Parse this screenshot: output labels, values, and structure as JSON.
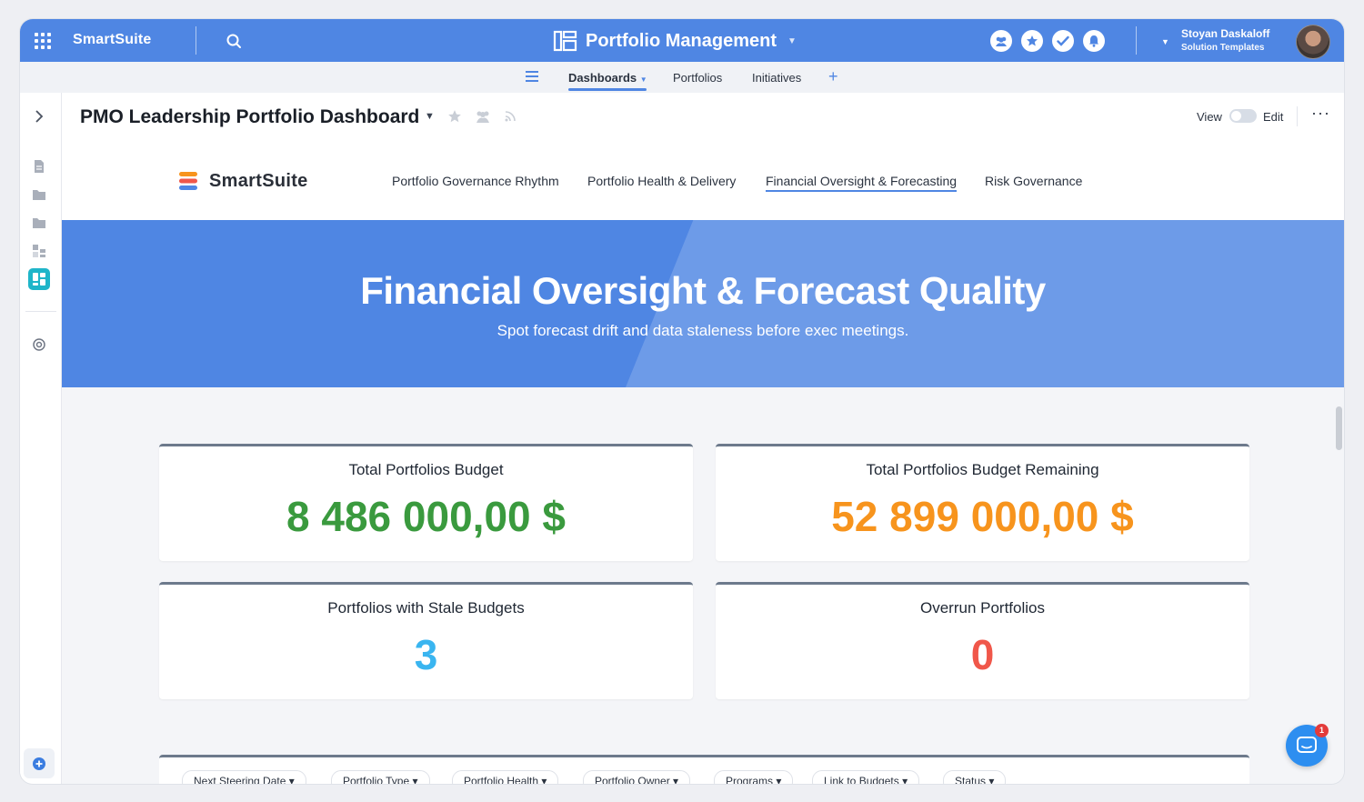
{
  "topbar": {
    "brand": "SmartSuite",
    "app_title": "Portfolio Management",
    "user_name": "Stoyan Daskaloff",
    "user_role": "Solution Templates"
  },
  "subnav": {
    "items": [
      "Dashboards",
      "Portfolios",
      "Initiatives"
    ],
    "active": "Dashboards"
  },
  "page": {
    "title": "PMO Leadership Portfolio Dashboard",
    "view_label": "View",
    "edit_label": "Edit"
  },
  "dashboard_nav": {
    "logo_text": "SmartSuite",
    "tabs": [
      "Portfolio Governance Rhythm",
      "Portfolio Health & Delivery",
      "Financial Oversight & Forecasting",
      "Risk Governance"
    ],
    "active_tab": "Financial Oversight & Forecasting"
  },
  "hero": {
    "title": "Financial Oversight & Forecast Quality",
    "subtitle": "Spot forecast drift and data staleness before exec meetings."
  },
  "metrics": [
    {
      "label": "Total Portfolios Budget",
      "value": "8 486 000,00 $",
      "color": "#3a9a3e"
    },
    {
      "label": "Total Portfolios Budget Remaining",
      "value": "52 899 000,00 $",
      "color": "#f7941d"
    },
    {
      "label": "Portfolios with Stale Budgets",
      "value": "3",
      "color": "#3ab5f0"
    },
    {
      "label": "Overrun Portfolios",
      "value": "0",
      "color": "#f0574a"
    }
  ],
  "filters": [
    "Next Steering Date",
    "Portfolio Type",
    "Portfolio Health",
    "Portfolio Owner",
    "Programs",
    "Link to Budgets",
    "Status"
  ],
  "chat": {
    "badge_count": "1"
  },
  "colors": {
    "primary": "#4f86e3",
    "accent_teal": "#1fb5c9"
  }
}
